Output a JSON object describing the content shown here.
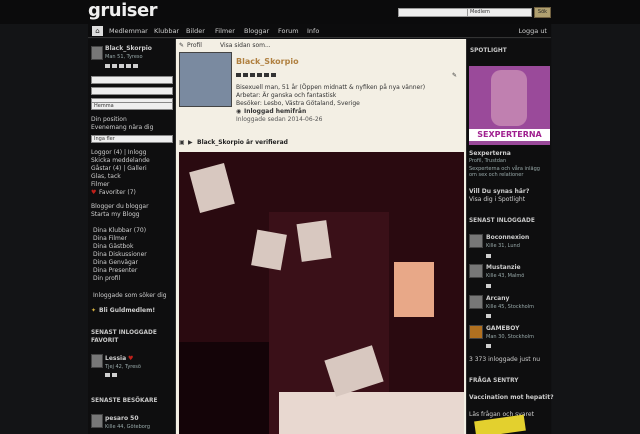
{
  "header": {
    "logo": "gruiser",
    "search_placeholder": "",
    "search_scope": "Medlem",
    "search_button": "Sök"
  },
  "nav": {
    "home_icon": "home-icon",
    "items": [
      "Medlemmar",
      "Klubbar",
      "Bilder",
      "Filmer",
      "Bloggar",
      "Forum",
      "Info"
    ],
    "logout": "Logga ut"
  },
  "left": {
    "username": "Black_Skorpio",
    "location": "Man 51, Tyreso",
    "status_select": "Hemma",
    "my_position": "Din position",
    "near_events": "Evenemang nära dig",
    "near_select": "Inga fler",
    "links_a": [
      "Loggor (4) | Inlogg",
      "Skicka meddelande",
      "Gåstar (4) | Galleri",
      "Glas, tack",
      "Filmer"
    ],
    "favorites": "Favoriter (7)",
    "blog_links": [
      "Blogger du bloggar",
      "Starta my Blogg"
    ],
    "profile_links": [
      "Dina Klubbar (70)",
      "Dina Filmer",
      "Dina Gästbok",
      "Dina Diskussioner",
      "Dina Genvägar",
      "Dina Presenter",
      "Din profil"
    ],
    "logged_in_link": "Inloggade som söker dig",
    "gold": "Bli Guldmedlem!",
    "recent_fav_heading": "SENAST INLOGGADE FAVORIT",
    "recent_fav_name": "Lessia",
    "recent_fav_info": "Tjej 42, Tyresö",
    "recent_visitor_heading": "SENASTE BESÖKARE",
    "recent_visitor_name": "pesaro 50",
    "recent_visitor_info": "Kille 44, Göteborg"
  },
  "profile": {
    "tabs": [
      "Profil",
      "Visa sidan som..."
    ],
    "name": "Black_Skorpio",
    "about_1": "Bisexuell man, 51 år (Öppen midnatt & nyfiken på nya vänner)",
    "about_2": "Arbetar: Är ganska och fantastisk",
    "about_3": "Besöker: Lesbo, Västra Götaland, Sverige",
    "online_status": "Inloggad hemifrån",
    "member_since": "Inloggade sedan 2014-06-26",
    "activity": "Black_Skorpio är verifierad"
  },
  "right": {
    "spotlight_heading": "SPOTLIGHT",
    "spotlight_banner": "SEXPERTERNA",
    "spotlight_name": "Sexperterna",
    "spotlight_sub": "Profil, Trustdan",
    "spotlight_text": "Sexperterna och våra inlägg om sex och relationer",
    "be_seen": "Vill Du synas här?",
    "be_seen_link": "Visa dig i Spotlight",
    "recent_heading": "SENAST INLOGGADE",
    "recent_users": [
      {
        "name": "Boconnexion",
        "info": "Kille 31, Lund"
      },
      {
        "name": "Mustanzie",
        "info": "Kille 43, Malmö"
      },
      {
        "name": "Arcany",
        "info": "Kille 45, Stockholm"
      },
      {
        "name": "GAMEBOY",
        "info": "Man 30, Stockholm"
      }
    ],
    "online_count": "3 373 inloggade just nu",
    "question_heading": "FRÅGA SENTRY",
    "question_title": "Vaccination mot hepatit?",
    "question_link": "Läs frågan och svaret"
  },
  "colors": {
    "accent_gold": "#b0a070",
    "favorite_heart": "#c0201a",
    "spotlight_bg": "#9a4a9a",
    "center_bg": "#f3efe4"
  }
}
